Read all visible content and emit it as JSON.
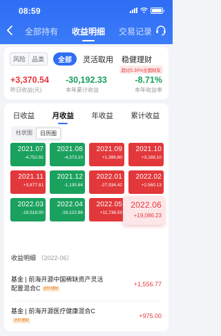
{
  "status": {
    "time": "08:59"
  },
  "nav": {
    "tabs": [
      {
        "label": "全部持有",
        "active": false
      },
      {
        "label": "收益明细",
        "active": true
      },
      {
        "label": "交易记录",
        "active": false
      }
    ]
  },
  "summary": {
    "chips": [
      "风险",
      "品类"
    ],
    "pill": "全部",
    "product_tabs": [
      "灵活取用",
      "稳健理财"
    ],
    "badge": "超过5.30%全国财友",
    "metrics": [
      {
        "value": "+3,370.54",
        "label": "昨日收益(元)",
        "color": "red"
      },
      {
        "value": "-30,192.33",
        "label": "本年累计收益",
        "color": "green"
      },
      {
        "value": "-8.71%",
        "label": "本年收益率",
        "color": "green"
      }
    ]
  },
  "report": {
    "tabs": [
      {
        "label": "日收益",
        "active": false
      },
      {
        "label": "月收益",
        "active": true
      },
      {
        "label": "年收益",
        "active": false
      },
      {
        "label": "累计收益",
        "active": false
      }
    ],
    "view_toggle": [
      {
        "label": "柱状图",
        "active": false
      },
      {
        "label": "日历图",
        "active": true
      }
    ],
    "months": [
      {
        "month": "2021.07",
        "amount": "-4,752.92",
        "trend": "down"
      },
      {
        "month": "2021.08",
        "amount": "-4,373.10",
        "trend": "down"
      },
      {
        "month": "2021.09",
        "amount": "+1,396.80",
        "trend": "up"
      },
      {
        "month": "2021.10",
        "amount": "+3,166.10",
        "trend": "up"
      },
      {
        "month": "2021.11",
        "amount": "+3,877.81",
        "trend": "up"
      },
      {
        "month": "2021.12",
        "amount": "-1,130.84",
        "trend": "down"
      },
      {
        "month": "2022.01",
        "amount": "-27,934.42",
        "trend": "up"
      },
      {
        "month": "2022.02",
        "amount": "+2,560.13",
        "trend": "up"
      },
      {
        "month": "2022.03",
        "amount": "-19,518.00",
        "trend": "down"
      },
      {
        "month": "2022.04",
        "amount": "-16,122.86",
        "trend": "down"
      },
      {
        "month": "2022.05",
        "amount": "+11,736.59",
        "trend": "up"
      },
      {
        "month": "2022.06",
        "amount": "+19,086.23",
        "trend": "selected"
      }
    ]
  },
  "details": {
    "title": "收益明细",
    "period": "（2022-06）",
    "items": [
      {
        "name": "基金 | 前海开源中国稀缺资产灵活配置混合C",
        "tag": "进阶理财",
        "amount": "+1,556.77"
      },
      {
        "name": "基金 | 前海开源医疗健康混合C",
        "tag": "进阶理财",
        "amount": "+975.00"
      }
    ]
  }
}
